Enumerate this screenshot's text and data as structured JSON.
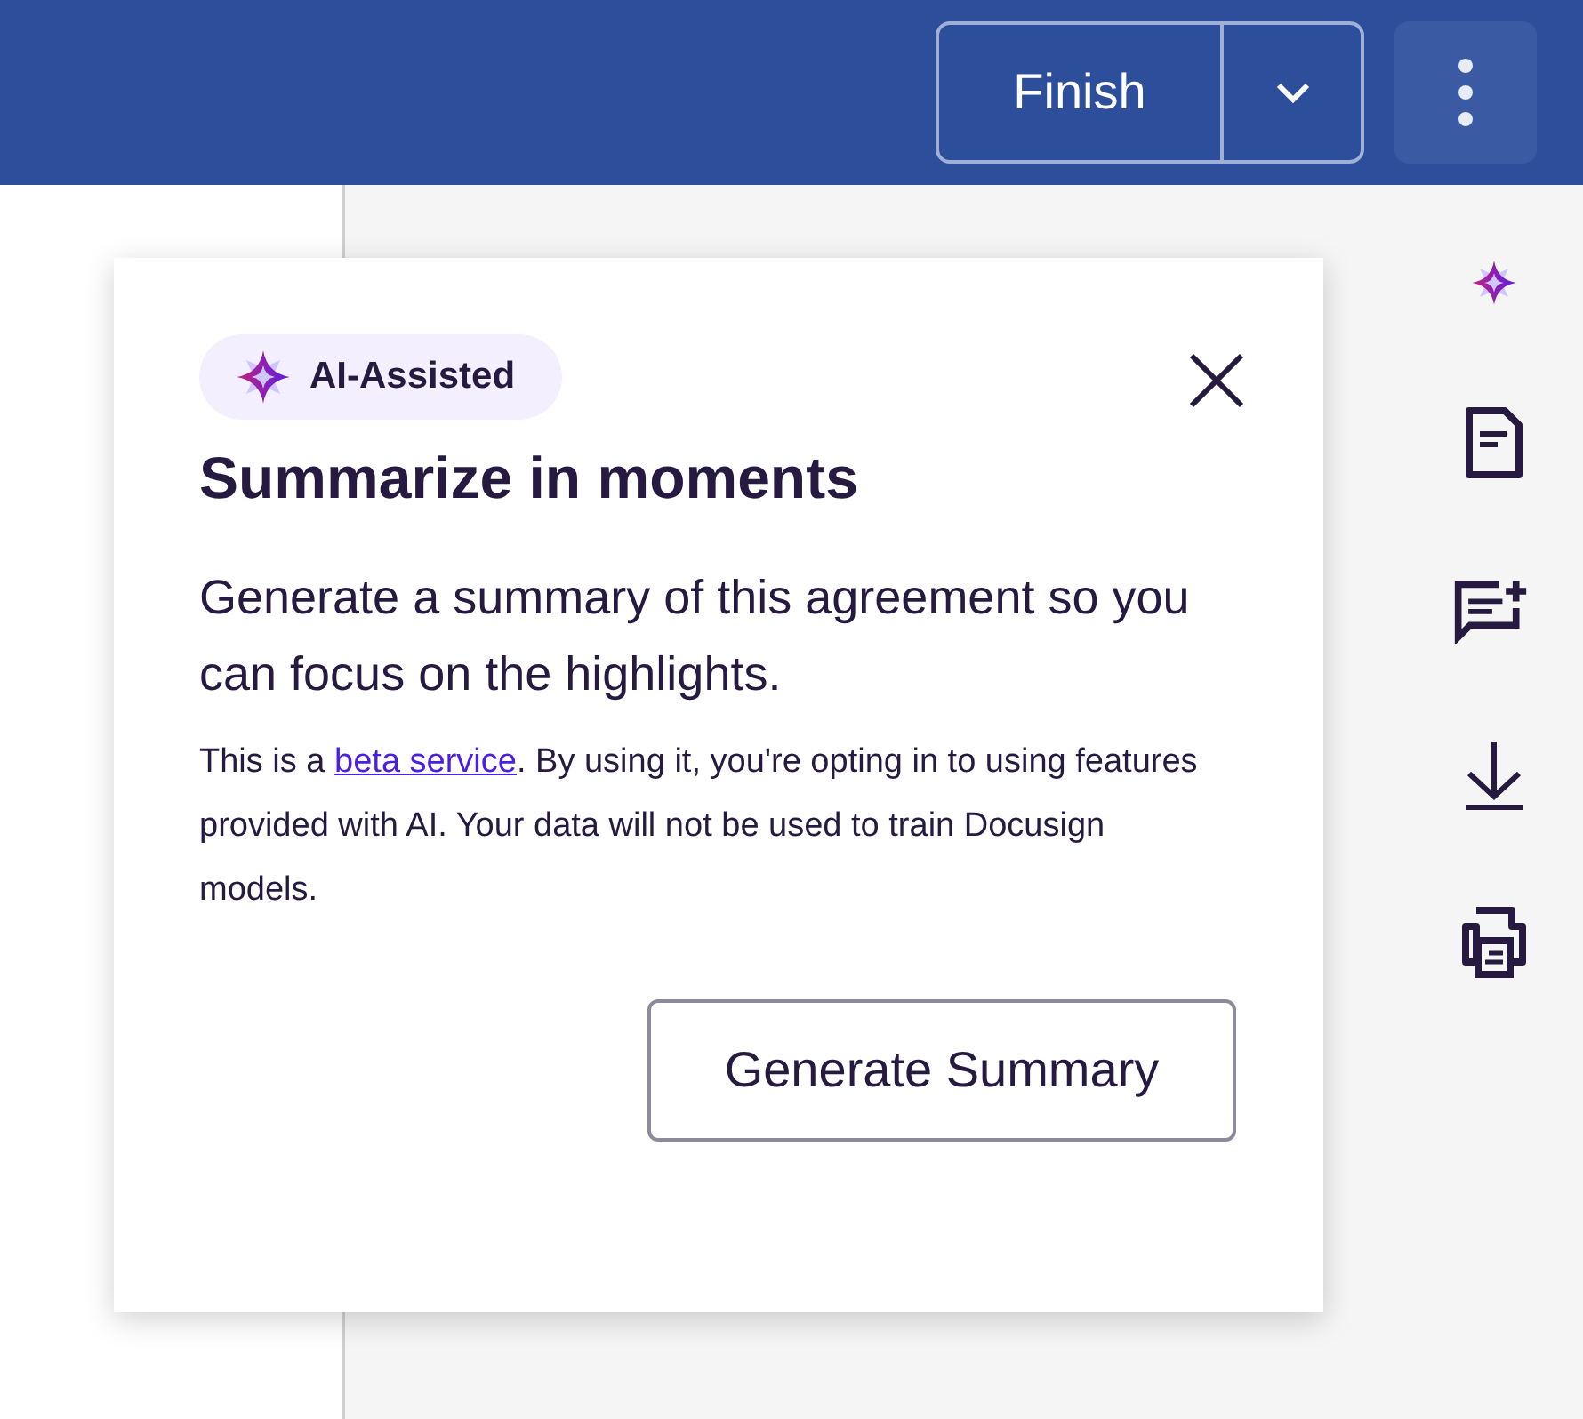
{
  "header": {
    "finish_button": "Finish"
  },
  "popover": {
    "badge": "AI-Assisted",
    "title": "Summarize in moments",
    "lead": "Generate a summary of this agreement so you can focus on the highlights.",
    "note": {
      "before": "This is a ",
      "link": "beta service",
      "after": ". By using it, you're opting in to using features provided with AI. Your data will not be used to train Docusign models."
    },
    "button": "Generate Summary"
  }
}
